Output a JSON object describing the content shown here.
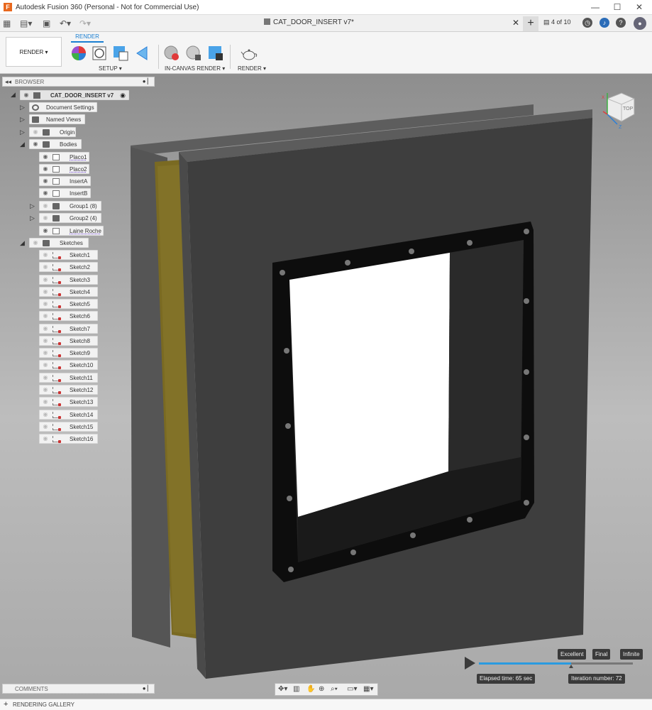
{
  "window": {
    "title": "Autodesk Fusion 360 (Personal - Not for Commercial Use)",
    "app_icon": "F",
    "min": "—",
    "max": "☐",
    "close": "✕"
  },
  "tabbar": {
    "doc_tab": "CAT_DOOR_INSERT v7*",
    "close": "✕",
    "new_tab": "+",
    "jobs": "4 of 10"
  },
  "toolbar": {
    "workspace": "RENDER ▾",
    "active_tab": "RENDER",
    "groups": {
      "setup": "SETUP ▾",
      "in_canvas": "IN-CANVAS RENDER ▾",
      "render": "RENDER ▾"
    }
  },
  "browser": {
    "label": "BROWSER",
    "root": "CAT_DOOR_INSERT v7",
    "items": {
      "doc_settings": "Document Settings",
      "named_views": "Named Views",
      "origin": "Origin",
      "bodies": "Bodies",
      "placo1": "Placo1",
      "placo2": "Placo2",
      "inserta": "InsertA",
      "insertb": "InsertB",
      "group1": "Group1 (8)",
      "group2": "Group2 (4)",
      "laine": "Laine Roche",
      "sketches": "Sketches"
    },
    "sketches": [
      "Sketch1",
      "Sketch2",
      "Sketch3",
      "Sketch4",
      "Sketch5",
      "Sketch6",
      "Sketch7",
      "Sketch8",
      "Sketch9",
      "Sketch10",
      "Sketch11",
      "Sketch12",
      "Sketch13",
      "Sketch14",
      "Sketch15",
      "Sketch16"
    ]
  },
  "viewcube": {
    "face": "TOP",
    "x": "X",
    "z": "Z"
  },
  "render": {
    "quality": [
      "Excellent",
      "Final",
      "Infinite"
    ],
    "elapsed": "Elapsed time: 65 sec",
    "iteration": "Iteration number: 72",
    "progress": 0.6
  },
  "comments": {
    "label": "COMMENTS"
  },
  "gallery": {
    "label": "RENDERING GALLERY"
  },
  "colors": {
    "accent": "#1b7fd1",
    "progress": "#2a9be0",
    "panel": "#3a3a3a",
    "insulation": "#7a6a22"
  }
}
